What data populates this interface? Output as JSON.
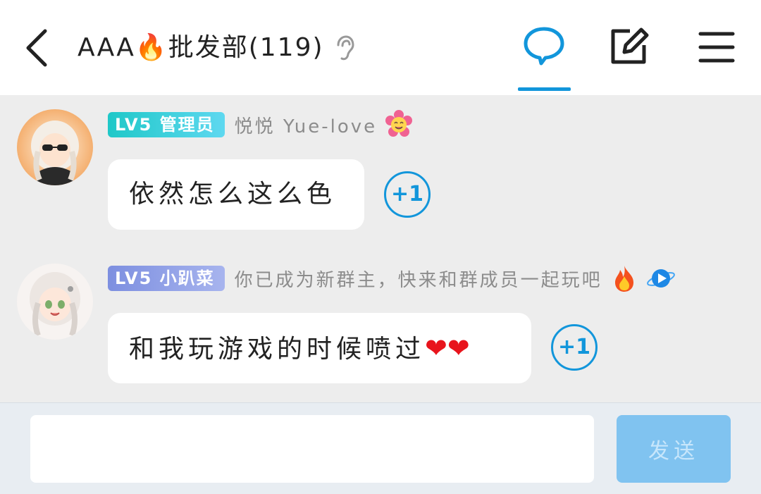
{
  "header": {
    "title": "AAA🔥批发部(119)",
    "accent_color": "#1296db",
    "icons": [
      "back-arrow-icon",
      "ear-icon",
      "chat-bubble-icon",
      "edit-icon",
      "menu-icon"
    ]
  },
  "messages": [
    {
      "badge": "LV5 管理员",
      "username": "悦悦  Yue-love",
      "text": "依然怎么这么色",
      "plus_one": "+1"
    },
    {
      "badge": "LV5 小趴菜",
      "username": "你已成为新群主，快来和群成员一起玩吧",
      "text": "和我玩游戏的时候喷过",
      "text_suffix": "❤❤",
      "plus_one": "+1"
    }
  ],
  "input": {
    "placeholder": "",
    "send_label": "发送"
  }
}
